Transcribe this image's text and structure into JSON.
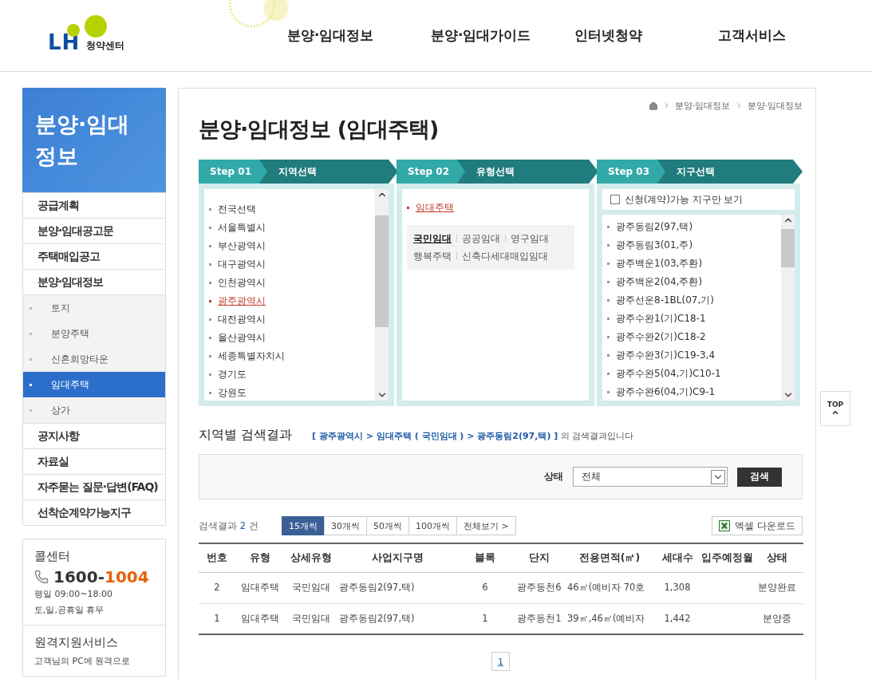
{
  "header": {
    "logo": {
      "mark": "LH",
      "text": "청약센터"
    },
    "nav": [
      "분양·임대정보",
      "분양·임대가이드",
      "인터넷청약",
      "고객서비스"
    ]
  },
  "sidebar": {
    "title": "분양·임대 정보",
    "menu": [
      {
        "label": "공급계획"
      },
      {
        "label": "분양·임대공고문"
      },
      {
        "label": "주택매입공고"
      },
      {
        "label": "분양·임대정보",
        "expanded": true,
        "children": [
          {
            "label": "토지",
            "selected": false
          },
          {
            "label": "분양주택",
            "selected": false
          },
          {
            "label": "신혼희망타운",
            "selected": false
          },
          {
            "label": "임대주택",
            "selected": true
          },
          {
            "label": "상가",
            "selected": false
          }
        ]
      },
      {
        "label": "공지사항"
      },
      {
        "label": "자료실"
      },
      {
        "label": "자주묻는 질문·답변(FAQ)"
      },
      {
        "label": "선착순계약가능지구"
      }
    ],
    "call_center": {
      "title": "콜센터",
      "phone_prefix": "1600-",
      "phone_highlight": "1004",
      "hours": [
        "평일 09:00~18:00",
        "토,일,공휴일 휴무"
      ]
    },
    "remote": {
      "title": "원격지원서비스",
      "text": "고객님의 PC에 원격으로"
    }
  },
  "breadcrumb": [
    "분양·임대정보",
    "분양·임대정보"
  ],
  "page_title": "분양·임대정보 (임대주택)",
  "steps": [
    {
      "step": "Step 01",
      "label": "지역선택"
    },
    {
      "step": "Step 02",
      "label": "유형선택"
    },
    {
      "step": "Step 03",
      "label": "지구선택"
    }
  ],
  "regions": [
    {
      "label": "전국선택",
      "selected": false
    },
    {
      "label": "서울특별시",
      "selected": false
    },
    {
      "label": "부산광역시",
      "selected": false
    },
    {
      "label": "대구광역시",
      "selected": false
    },
    {
      "label": "인천광역시",
      "selected": false
    },
    {
      "label": "광주광역시",
      "selected": true
    },
    {
      "label": "대전광역시",
      "selected": false
    },
    {
      "label": "울산광역시",
      "selected": false
    },
    {
      "label": "세종특별자치시",
      "selected": false
    },
    {
      "label": "경기도",
      "selected": false
    },
    {
      "label": "강원도",
      "selected": false
    }
  ],
  "types": {
    "category": {
      "label": "임대주택",
      "selected": true
    },
    "subtypes": [
      [
        {
          "label": "국민임대",
          "selected": true
        },
        {
          "label": "공공임대",
          "selected": false
        },
        {
          "label": "영구임대",
          "selected": false
        }
      ],
      [
        {
          "label": "행복주택",
          "selected": false
        },
        {
          "label": "신축다세대매입임대",
          "selected": false
        }
      ]
    ]
  },
  "districts": {
    "filter": {
      "label": "신청(계약)가능 지구만 보기",
      "checked": false
    },
    "items": [
      "광주동림2(97,택)",
      "광주동림3(01,주)",
      "광주백운1(03,주환)",
      "광주백운2(04,주환)",
      "광주선운8-1BL(07,기)",
      "광주수완1(기)C18-1",
      "광주수완2(기)C18-2",
      "광주수완3(기)C19-3,4",
      "광주수완5(04,기)C10-1",
      "광주수완6(04,기)C9-1"
    ]
  },
  "results": {
    "title": "지역별 검색결과",
    "path": "[ 광주광역시 > 임대주택 ( 국민임대 ) > 광주동림2(97,택) ]",
    "suffix": "의 검색결과입니다",
    "filter": {
      "label": "상태",
      "value": "전체",
      "button": "검색"
    },
    "count": {
      "label": "검색결과",
      "value": "2",
      "unit": "건"
    },
    "page_sizes": [
      {
        "label": "15개씩",
        "selected": true
      },
      {
        "label": "30개씩",
        "selected": false
      },
      {
        "label": "50개씩",
        "selected": false
      },
      {
        "label": "100개씩",
        "selected": false
      },
      {
        "label": "전체보기 >",
        "selected": false
      }
    ],
    "excel_button": "엑셀 다운로드",
    "table": {
      "columns": [
        "번호",
        "유형",
        "상세유형",
        "사업지구명",
        "블록",
        "단지",
        "전용면적(㎡)",
        "세대수",
        "입주예정월",
        "상태"
      ],
      "rows": [
        [
          "2",
          "임대주택",
          "국민임대",
          "광주동림2(97,택)",
          "6",
          "광주동천6",
          "46㎡(예비자 70호",
          "1,308",
          "",
          "분양완료"
        ],
        [
          "1",
          "임대주택",
          "국민임대",
          "광주동림2(97,택)",
          "1",
          "광주동천1",
          "39㎡,46㎡(예비자",
          "1,442",
          "",
          "분양중"
        ]
      ]
    },
    "pagination": [
      {
        "label": "1",
        "selected": true
      }
    ]
  },
  "top_button": "TOP"
}
